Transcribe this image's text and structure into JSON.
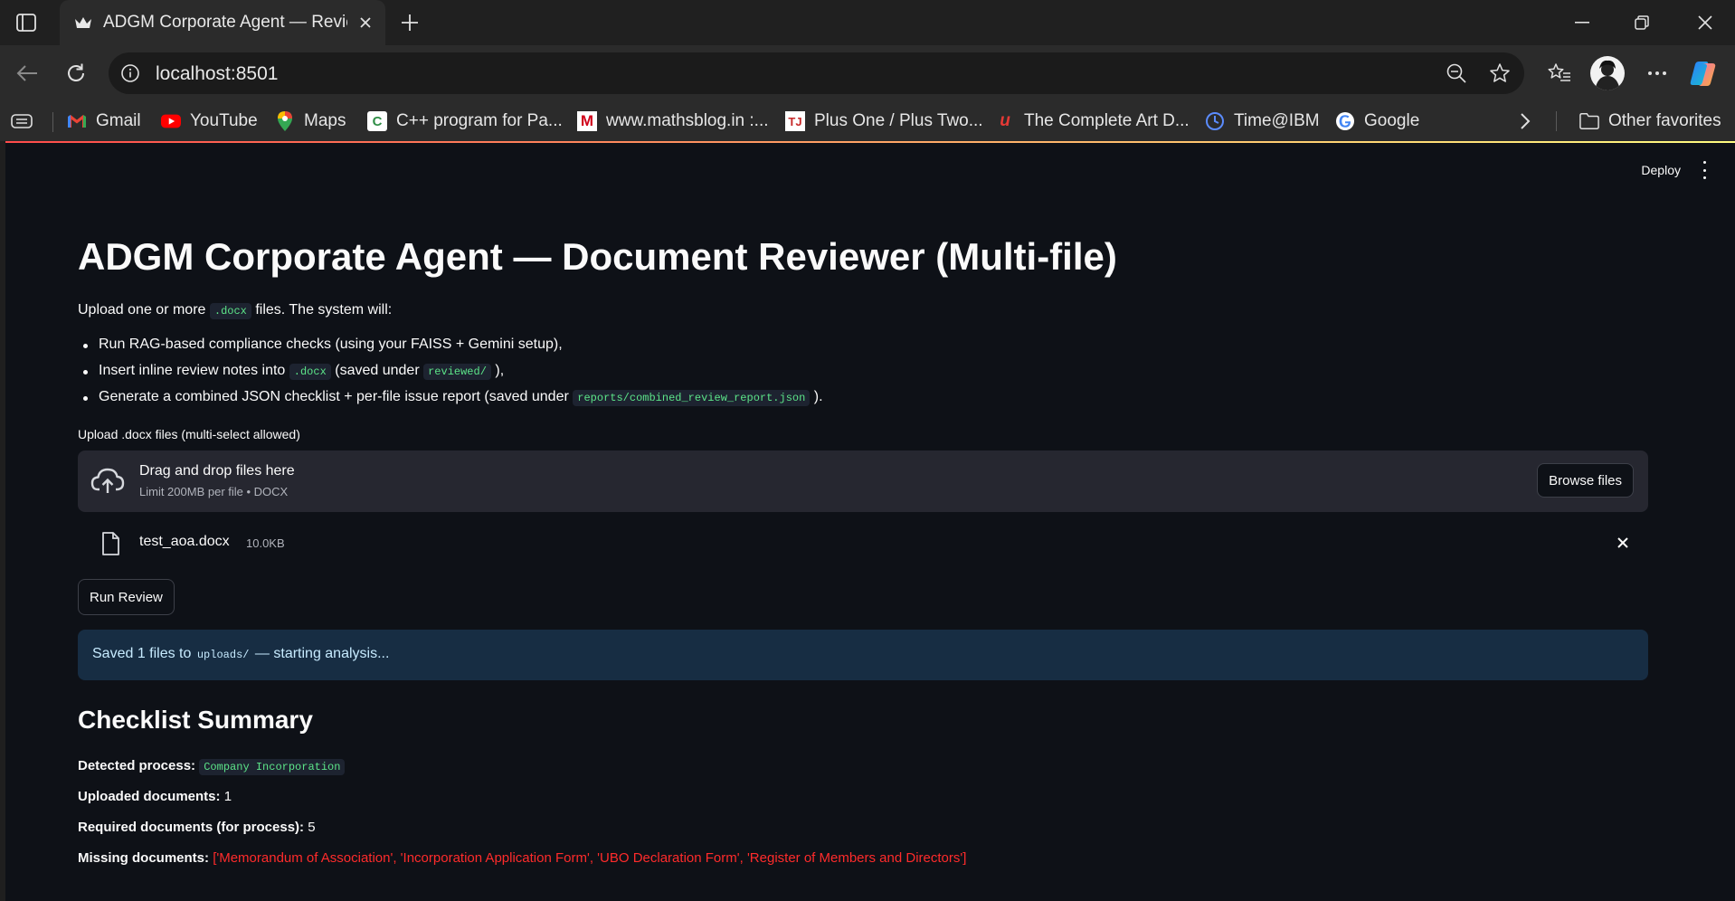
{
  "browser": {
    "tab_title": "ADGM Corporate Agent — Reviewer",
    "url": "localhost:8501",
    "bookmarks": [
      {
        "label": "Gmail",
        "icon": "gmail-icon"
      },
      {
        "label": "YouTube",
        "icon": "youtube-icon"
      },
      {
        "label": "Maps",
        "icon": "maps-icon"
      },
      {
        "label": "C++ program for Pa...",
        "icon": "cpp-icon"
      },
      {
        "label": "www.mathsblog.in :...",
        "icon": "mathsblog-icon"
      },
      {
        "label": "Plus One / Plus Two...",
        "icon": "tj-icon"
      },
      {
        "label": "The Complete Art D...",
        "icon": "art-icon"
      },
      {
        "label": "Time@IBM",
        "icon": "clock-icon"
      },
      {
        "label": "Google",
        "icon": "google-icon"
      }
    ],
    "other_favorites": "Other favorites"
  },
  "app": {
    "deploy_label": "Deploy",
    "title": "ADGM Corporate Agent — Document Reviewer (Multi-file)",
    "intro_prefix": "Upload one or more",
    "intro_code": ".docx",
    "intro_suffix": "files. The system will:",
    "bullets": {
      "b1": "Run RAG-based compliance checks (using your FAISS + Gemini setup),",
      "b2_pre": "Insert inline review notes into",
      "b2_code1": ".docx",
      "b2_mid": "(saved under",
      "b2_code2": "reviewed/",
      "b2_post": "),",
      "b3_pre": "Generate a combined JSON checklist + per-file issue report (saved under",
      "b3_code": "reports/combined_review_report.json",
      "b3_post": ")."
    },
    "upload_label": "Upload .docx files (multi-select allowed)",
    "dropzone_title": "Drag and drop files here",
    "dropzone_limit": "Limit 200MB per file • DOCX",
    "browse_label": "Browse files",
    "file": {
      "name": "test_aoa.docx",
      "size": "10.0KB"
    },
    "run_label": "Run Review",
    "alert": {
      "pre": "Saved 1 files to",
      "code": "uploads/",
      "post": "— starting analysis..."
    },
    "summary": {
      "heading": "Checklist Summary",
      "process_label": "Detected process:",
      "process_value": "Company Incorporation",
      "uploaded_label": "Uploaded documents:",
      "uploaded_value": "1",
      "required_label": "Required documents (for process):",
      "required_value": "5",
      "missing_label": "Missing documents:",
      "missing_value": "['Memorandum of Association', 'Incorporation Application Form', 'UBO Declaration Form', 'Register of Members and Directors']"
    }
  },
  "colors": {
    "page_bg": "#0e1117",
    "code_green": "#5ce488",
    "info_bg": "#172d43",
    "missing_red": "#ff2b2b"
  }
}
